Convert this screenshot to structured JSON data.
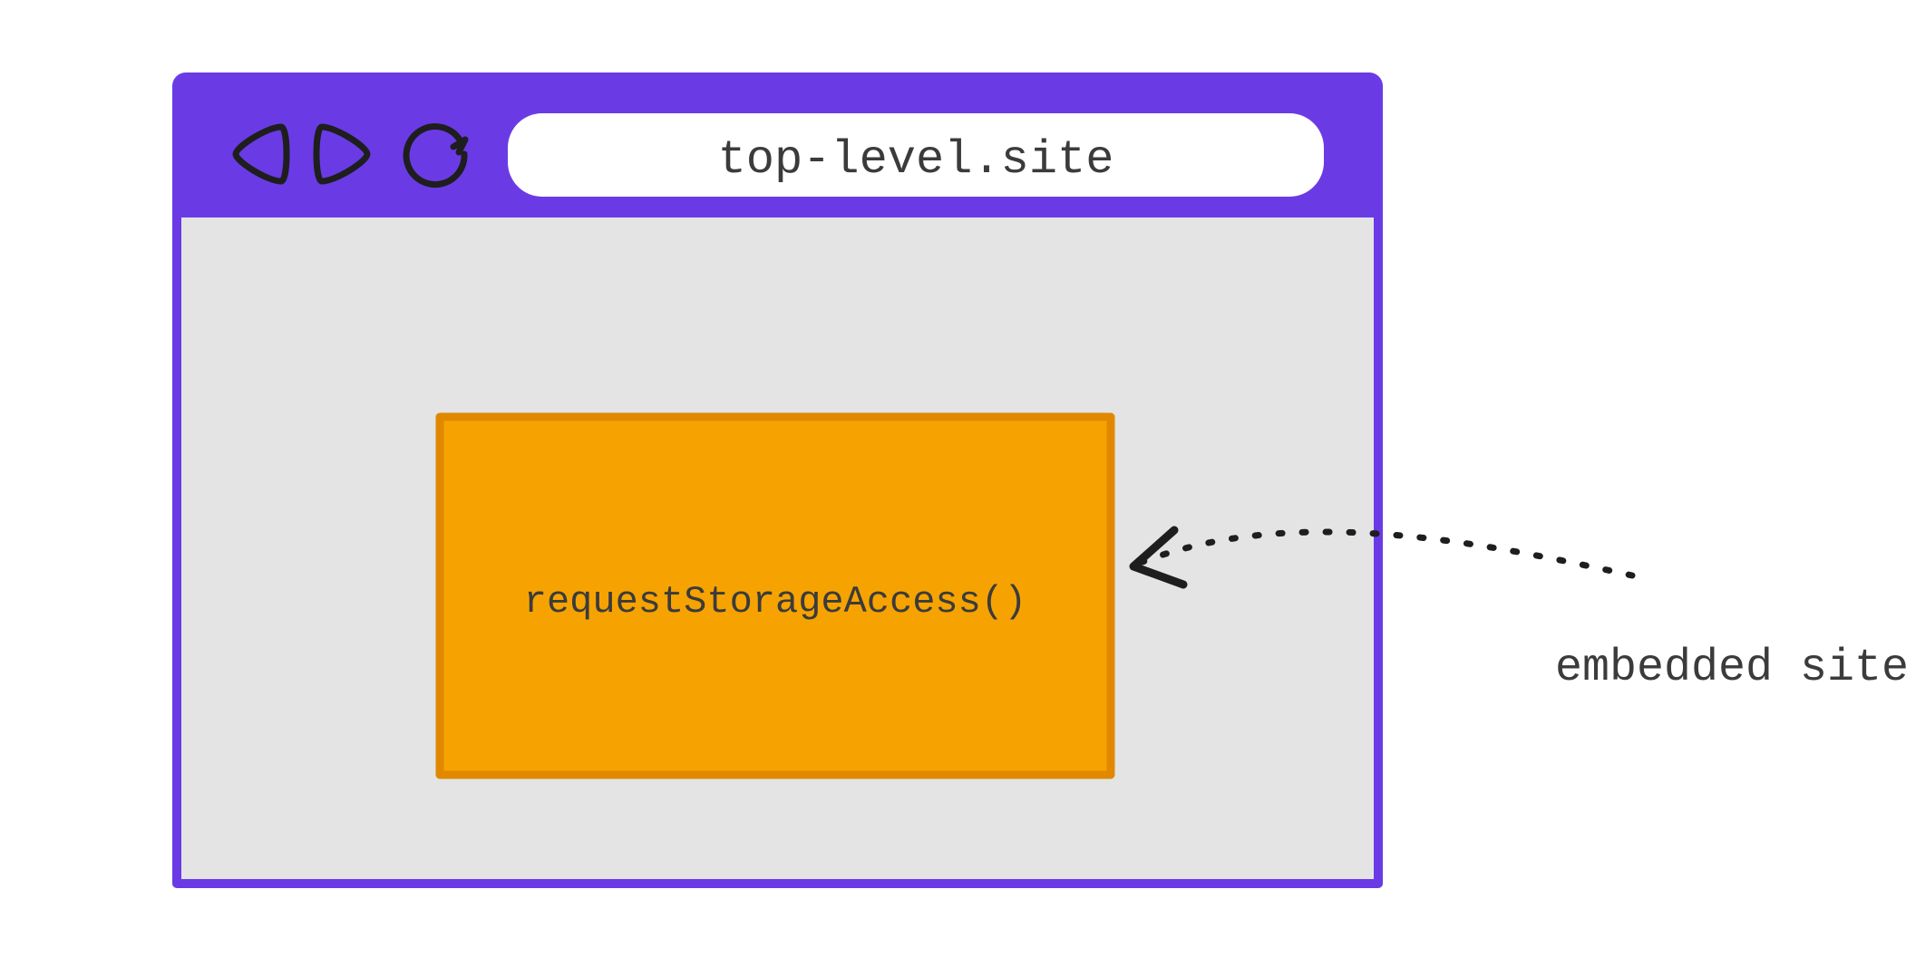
{
  "browser": {
    "address_bar": {
      "url": "top-level.site"
    },
    "controls": {
      "back_icon": "back",
      "forward_icon": "forward",
      "reload_icon": "reload"
    }
  },
  "iframe": {
    "api_call": "requestStorageAccess()"
  },
  "annotation": {
    "label": "embedded site"
  },
  "colors": {
    "purple": "#6A3BE5",
    "browser_border": "#6A3BE5",
    "viewport_bg": "#E4E4E4",
    "iframe_fill": "#F6A302",
    "iframe_stroke": "#E08900",
    "text": "#3B3B3B",
    "icon_stroke": "#1E1E1E"
  }
}
